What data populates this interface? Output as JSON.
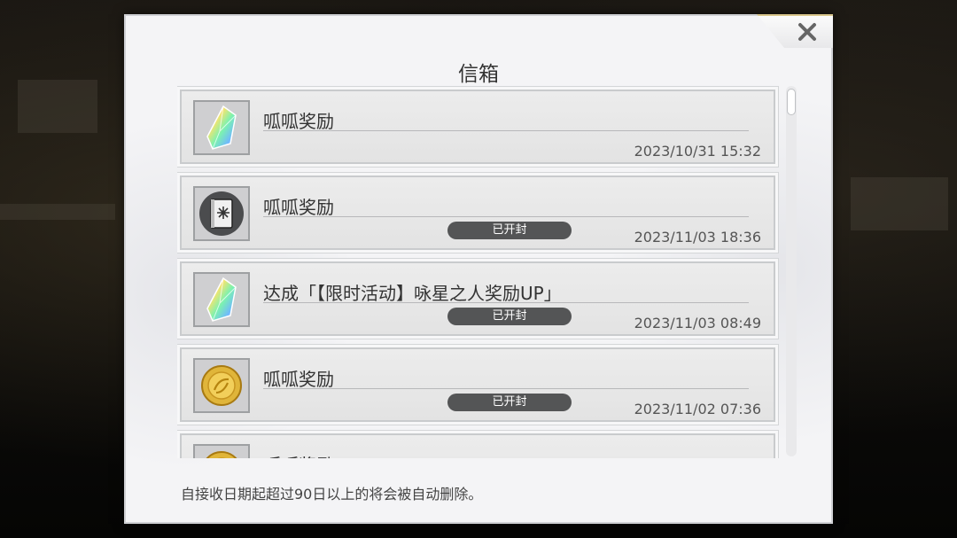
{
  "dialog": {
    "title": "信箱",
    "footer_note": "自接收日期起超过90日以上的将会被自动删除。"
  },
  "icons": {
    "close": "close-icon",
    "crystal": "rainbow-crystal-icon",
    "book": "book-icon",
    "coin": "gold-coin-icon"
  },
  "colors": {
    "badge_bg": "#545556",
    "panel_bg": "#f4f4f6",
    "coin_gold": "#e0b53a"
  },
  "mails": [
    {
      "title": "呱呱奖励",
      "date": "2023/10/31 15:32",
      "badge": "",
      "icon": "rainbow-crystal-icon"
    },
    {
      "title": "呱呱奖励",
      "date": "2023/11/03 18:36",
      "badge": "已开封",
      "icon": "book-icon"
    },
    {
      "title": "达成「【限时活动】咏星之人奖励UP」",
      "date": "2023/11/03 08:49",
      "badge": "已开封",
      "icon": "rainbow-crystal-icon"
    },
    {
      "title": "呱呱奖励",
      "date": "2023/11/02 07:36",
      "badge": "已开封",
      "icon": "gold-coin-icon"
    },
    {
      "title": "呱呱奖励",
      "date": "",
      "badge": "",
      "icon": "gold-coin-icon"
    }
  ]
}
